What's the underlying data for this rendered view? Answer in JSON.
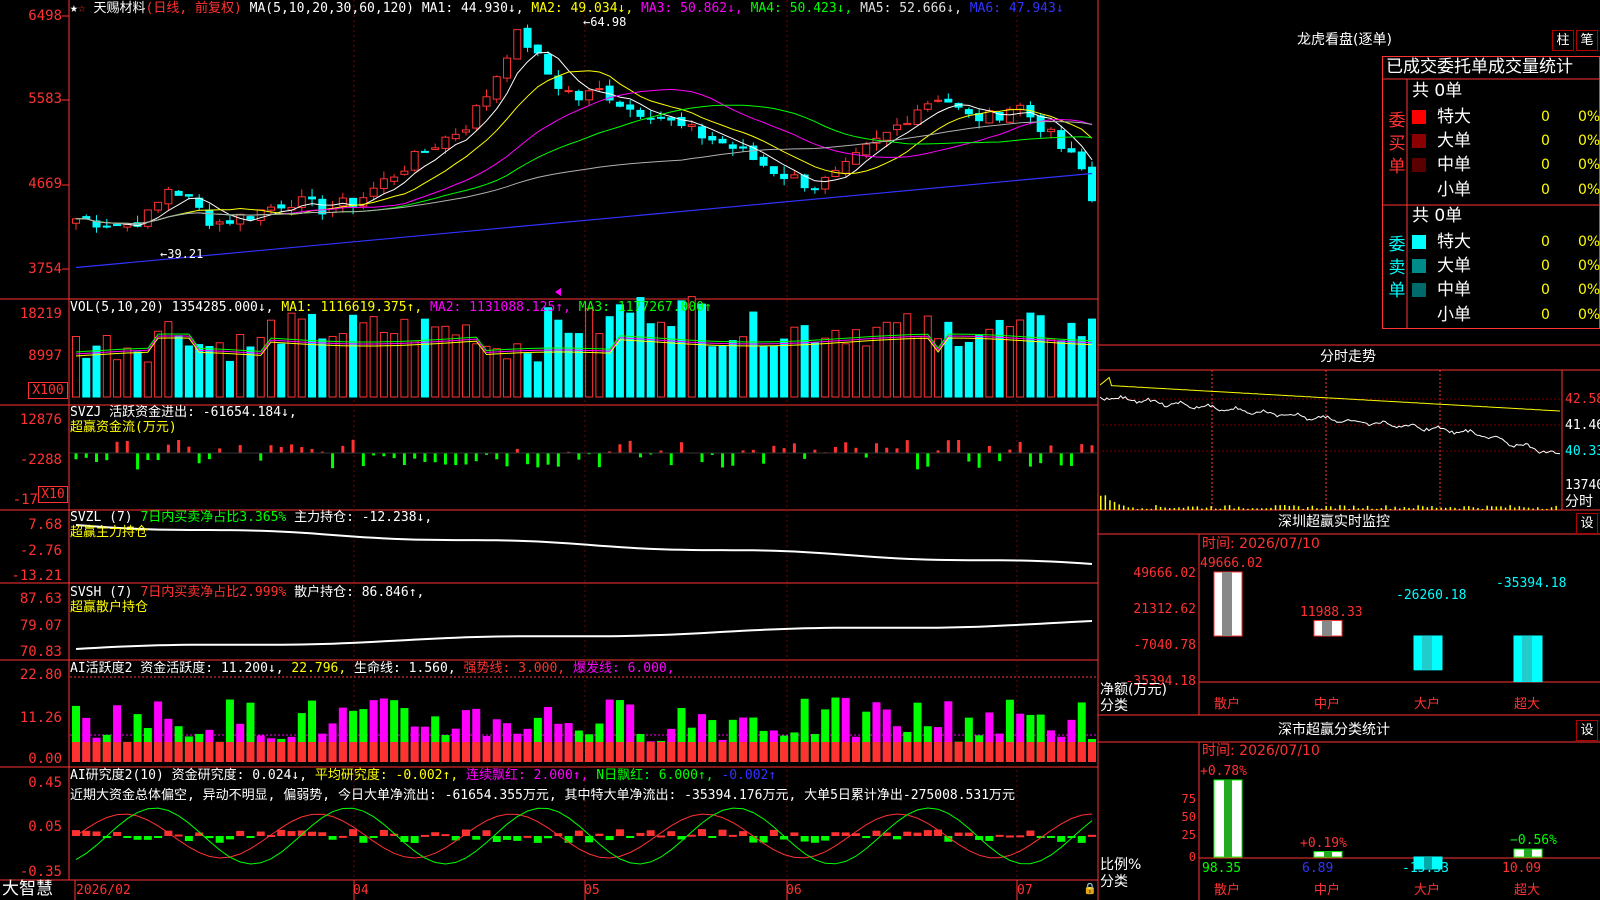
{
  "stock": {
    "title": "天赐材料",
    "mode": "(日线, 前复权)"
  },
  "colors": {
    "up": "#ff3232",
    "down": "#00ffff",
    "ma1": "#ffffff",
    "ma2": "#ffff00",
    "ma3": "#ff00ff",
    "ma4": "#00ff00",
    "ma5": "#b0b0b0",
    "ma6": "#3232ff",
    "accent": "#ffff00"
  },
  "main": {
    "params": "MA(5,10,20,30,60,120)",
    "ma": [
      "MA1: 44.930↓,",
      "MA2: 49.034↓,",
      "MA3: 50.862↓,",
      "MA4: 50.423↓,",
      "MA5: 52.666↓,",
      "MA6: 47.943↓"
    ],
    "yticks": [
      "6498",
      "5583",
      "4669",
      "3754"
    ],
    "high": "←64.98",
    "low": "←39.21",
    "ylim": [
      37.54,
      64.98
    ]
  },
  "vol": {
    "line": "VOL(5,10,20)",
    "value": "1354285.000↓,",
    "ma1": "MA1: 1116619.375↑,",
    "ma2": "MA2: 1131088.125↑,",
    "ma3": "MA3: 1177267.000↑",
    "yticks": [
      "18219",
      "8997"
    ],
    "unit": "X100"
  },
  "svzj": {
    "line": "SVZJ  活跃资金进出: -61654.184↓,",
    "name": "超赢资金流(万元)",
    "yticks": [
      "12876",
      "-2288",
      "-17"
    ],
    "unit": "X10"
  },
  "svzl": {
    "prefix": "SVZL (7)",
    "ratio": "7日内买卖净占比3.365%",
    "hold": "主力持仓: -12.238↓,",
    "name": "超赢主力持仓",
    "yticks": [
      "7.68",
      "-2.76",
      "-13.21"
    ]
  },
  "svsh": {
    "prefix": "SVSH (7)",
    "ratio": "7日内买卖净占比2.999%",
    "hold": "散户持仓: 86.846↑,",
    "name": "超赢散户持仓",
    "yticks": [
      "87.63",
      "79.07",
      "70.83"
    ]
  },
  "ai1": {
    "prefix": "AI活跃度2 资金活跃度: 11.200↓,",
    "v2": "22.796,",
    "life": "生命线: 1.560,",
    "strong": "强势线: 3.000,",
    "burst": "爆发线: 6.000,",
    "yticks": [
      "22.80",
      "11.26",
      "0.00"
    ]
  },
  "ai2": {
    "prefix": "AI研究度2(10) 资金研究度: 0.024↓,",
    "avg": "平均研究度: -0.002↑,",
    "lian": "连续飘红: 2.000↑,",
    "nday": "N日飘红: 6.000↑,",
    "last": "-0.002↑",
    "desc": "近期大资金总体偏空, 异动不明显, 偏弱势, 今日大单净流出: -61654.355万元, 其中特大单净流出: -35394.176万元, 大单5日累计净出-275008.531万元",
    "yticks": [
      "0.45",
      "0.05",
      "-0.35"
    ]
  },
  "bottom": {
    "logo": "大智慧",
    "dates": [
      "2026/02",
      "04",
      "05",
      "06",
      "07"
    ]
  },
  "lhb": {
    "title": "龙虎看盘(逐单)",
    "btn1": "柱",
    "btn2": "笔",
    "subtitle": "已成交委托单成交量统计",
    "buy": {
      "side": [
        "委",
        "买",
        "单"
      ],
      "total": "共 0单",
      "rows": [
        {
          "label": "特大",
          "count": "0",
          "pct": "0%",
          "color": "#ff0000"
        },
        {
          "label": "大单",
          "count": "0",
          "pct": "0%",
          "color": "#8b0000"
        },
        {
          "label": "中单",
          "count": "0",
          "pct": "0%",
          "color": "#5a0000"
        },
        {
          "label": "小单",
          "count": "0",
          "pct": "0%",
          "color": ""
        }
      ]
    },
    "sell": {
      "side": [
        "委",
        "卖",
        "单"
      ],
      "total": "共 0单",
      "rows": [
        {
          "label": "特大",
          "count": "0",
          "pct": "0%",
          "color": "#00ffff"
        },
        {
          "label": "大单",
          "count": "0",
          "pct": "0%",
          "color": "#008b8b"
        },
        {
          "label": "中单",
          "count": "0",
          "pct": "0%",
          "color": "#006a6a"
        },
        {
          "label": "小单",
          "count": "0",
          "pct": "0%",
          "color": ""
        }
      ]
    }
  },
  "intraday": {
    "title": "分时走势",
    "yticks": [
      "42.58",
      "41.46",
      "40.33"
    ],
    "vol": "13740",
    "label": "分时"
  },
  "monitor": {
    "title": "深圳超赢实时监控",
    "btn": "设",
    "time": "时间: 2026/07/10",
    "yticks": [
      "49666.02",
      "21312.62",
      "-7040.78",
      "-35394.18"
    ],
    "ylabel1": "净额(万元)",
    "ylabel2": "分类",
    "cats": [
      "散户",
      "中户",
      "大户",
      "超大"
    ],
    "values": [
      49666.02,
      11988.33,
      -26260.18,
      -35394.18
    ],
    "labels": [
      "49666.02",
      "11988.33",
      "-26260.18",
      "-35394.18"
    ]
  },
  "stats": {
    "title": "深市超赢分类统计",
    "btn": "设",
    "time": "时间: 2026/07/10",
    "yticks": [
      "75",
      "50",
      "25",
      "0"
    ],
    "ylabel1": "比例%",
    "ylabel2": "分类",
    "cats": [
      "散户",
      "中户",
      "大户",
      "超大"
    ],
    "values": [
      98.35,
      6.89,
      -15.33,
      10.09
    ],
    "tops": [
      "+0.78%",
      "+0.19%",
      "",
      "−0.56%"
    ],
    "labels": [
      "98.35",
      "6.89",
      "-15.33",
      "10.09"
    ]
  }
}
